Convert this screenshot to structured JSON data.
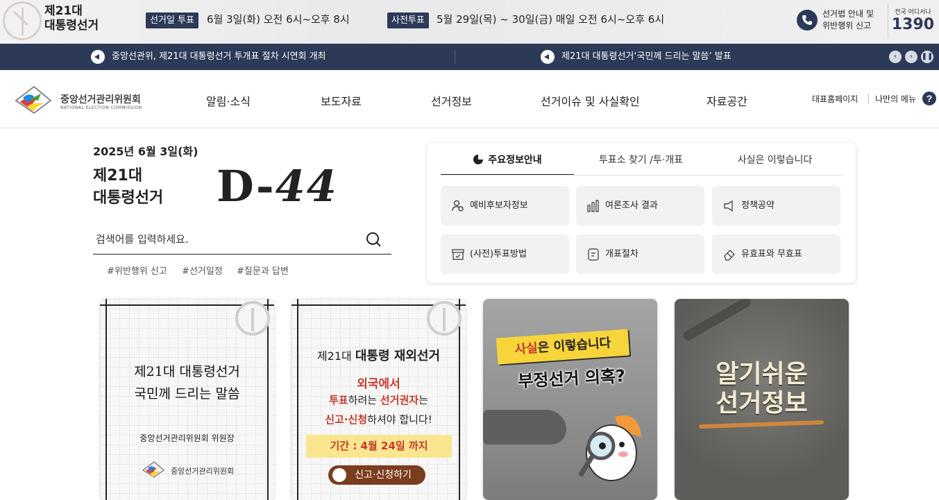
{
  "top_banner": {
    "election_title_line1": "제21대",
    "election_title_line2": "대통령선거",
    "election_day_tag": "선거일 투표",
    "election_day_date": "6월 3일(화) 오전 6시~오후 8시",
    "early_vote_tag": "사전투표",
    "early_vote_date": "5월 29일(목) ~ 30일(금) 매일 오전 6시~오후 6시",
    "report_line1": "선거법 안내 및",
    "report_line2": "위반행위 신고",
    "hotline_label": "전국 어디서나",
    "hotline_number": "1390"
  },
  "news_ticker": {
    "items": [
      "중앙선관위, 제21대 대통령선거 투개표 절차 시연회 개최",
      "제21대 대통령선거‘국민께 드리는 말씀’ 발표"
    ],
    "prev_icon": "chevron-left-icon",
    "next_icon": "chevron-right-icon",
    "pause_icon": "pause-icon"
  },
  "header": {
    "logo_name": "중앙선거관리위원회",
    "logo_sub": "NATIONAL ELECTION COMMISSION",
    "nav": [
      "알림·소식",
      "보도자료",
      "선거정보",
      "선거이슈 및 사실확인",
      "자료공간"
    ],
    "util_home": "대표홈페이지",
    "util_menu": "나만의 메뉴",
    "help_icon": "question-icon"
  },
  "dday": {
    "date": "2025년 6월 3일(화)",
    "title_line1": "제21대",
    "title_line2": "대통령선거",
    "prefix": "D-",
    "count": "44"
  },
  "search": {
    "placeholder": "검색어를 입력하세요.",
    "hashtags": [
      "#위반행위 신고",
      "#선거일정",
      "#질문과 답변"
    ]
  },
  "info_panel": {
    "tabs": [
      "주요정보안내",
      "투표소 찾기 /투·개표",
      "사실은 이렇습니다"
    ],
    "tiles": [
      {
        "label": "예비후보자정보",
        "icon": "candidate-icon"
      },
      {
        "label": "여론조사 결과",
        "icon": "bar-chart-icon"
      },
      {
        "label": "정책공약",
        "icon": "megaphone-icon"
      },
      {
        "label": "(사전)투표방법",
        "icon": "ballot-box-icon"
      },
      {
        "label": "개표절차",
        "icon": "document-icon"
      },
      {
        "label": "유효표와 무효표",
        "icon": "eraser-icon"
      }
    ]
  },
  "cards": {
    "card1": {
      "line1": "제21대 대통령선거",
      "line2": "국민께 드리는 말씀",
      "line3": "중앙선거관리위원회 위원장",
      "org": "중앙선거관리위원회"
    },
    "card2": {
      "line1_prefix": "제21대",
      "line1_main": "대통령 재외선거",
      "line2": "외국에서",
      "line3_a": "투표",
      "line3_b": "하려는 ",
      "line3_c": "선거권자",
      "line3_d": "는",
      "line4_a": "신고·신청",
      "line4_b": "하셔야 합니다!",
      "period": "기간 : 4월 24일 까지",
      "button": "신고·신청하기"
    },
    "card3": {
      "banner_a": "사실",
      "banner_b": "은 이렇습니다",
      "title": "부정선거 의혹?"
    },
    "card4": {
      "title_line1": "알기쉬운",
      "title_line2": "선거정보"
    }
  },
  "colors": {
    "navy": "#2c3a58",
    "accent_red": "#c63a2a",
    "highlight_yellow": "#fbe690"
  }
}
